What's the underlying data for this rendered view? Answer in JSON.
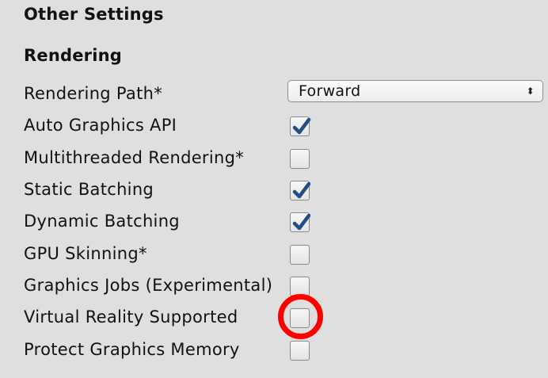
{
  "section": {
    "title": "Other Settings"
  },
  "rendering": {
    "title": "Rendering",
    "rendering_path": {
      "label": "Rendering Path*",
      "value": "Forward",
      "arrow": "⬍"
    },
    "options": [
      {
        "label": "Auto Graphics API",
        "checked": true
      },
      {
        "label": "Multithreaded Rendering*",
        "checked": false
      },
      {
        "label": "Static Batching",
        "checked": true
      },
      {
        "label": "Dynamic Batching",
        "checked": true
      },
      {
        "label": "GPU Skinning*",
        "checked": false
      },
      {
        "label": "Graphics Jobs (Experimental)",
        "checked": false
      },
      {
        "label": "Virtual Reality Supported",
        "checked": false
      },
      {
        "label": "Protect Graphics Memory",
        "checked": false
      }
    ]
  },
  "annotation": {
    "highlight_color": "#ff0000",
    "highlighted_option": "Virtual Reality Supported"
  },
  "colors": {
    "background": "#dfdfdf",
    "check_color": "#1f4f88"
  }
}
